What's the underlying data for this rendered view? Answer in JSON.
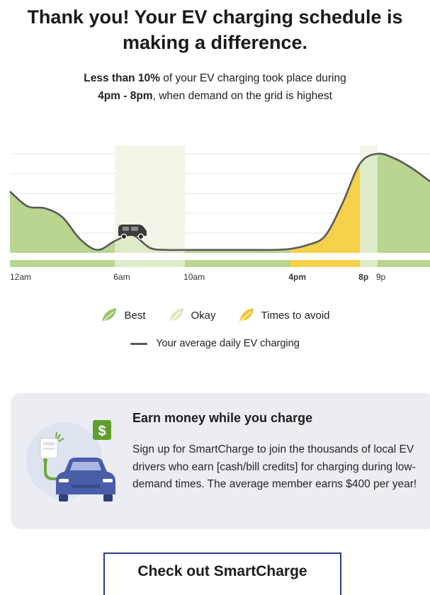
{
  "header": {
    "title": "Thank you! Your EV charging schedule is making a difference.",
    "sub_b1": "Less than 10%",
    "sub_t1": " of your EV charging took place during ",
    "sub_b2": "4pm - 8pm",
    "sub_t2": ", when demand on the grid is highest"
  },
  "chart_data": {
    "type": "area",
    "x": [
      0,
      1,
      2,
      3,
      4,
      5,
      6,
      7,
      8,
      9,
      10,
      11,
      12,
      13,
      14,
      15,
      16,
      17,
      18,
      19,
      20,
      21,
      22,
      23,
      24
    ],
    "series": [
      {
        "values": [
          0.62,
          0.47,
          0.45,
          0.36,
          0.14,
          0.03,
          0.12,
          0.18,
          0.05,
          0.03,
          0.03,
          0.03,
          0.03,
          0.03,
          0.03,
          0.03,
          0.04,
          0.08,
          0.17,
          0.5,
          0.9,
          1.0,
          0.95,
          0.85,
          0.72
        ]
      }
    ],
    "tick_labels": [
      {
        "x": 0,
        "label": "12am",
        "bold": false
      },
      {
        "x": 6,
        "label": "6am",
        "bold": false
      },
      {
        "x": 10,
        "label": "10am",
        "bold": false
      },
      {
        "x": 16,
        "label": "4pm",
        "bold": true
      },
      {
        "x": 20,
        "label": "8p",
        "bold": true
      },
      {
        "x": 21,
        "label": "9p",
        "bold": false
      }
    ],
    "bands": [
      {
        "from": 0,
        "to": 6,
        "category": "best"
      },
      {
        "from": 6,
        "to": 10,
        "category": "okay"
      },
      {
        "from": 10,
        "to": 16,
        "category": "best"
      },
      {
        "from": 16,
        "to": 20,
        "category": "avoid"
      },
      {
        "from": 20,
        "to": 21,
        "category": "okay"
      },
      {
        "from": 21,
        "to": 24,
        "category": "best"
      }
    ],
    "car_marker_x": 7,
    "grid": true,
    "colors": {
      "best": "#b9d58f",
      "okay": "#deebc8",
      "avoid": "#f5d04a",
      "line": "#5a5a5a",
      "grid": "#e4e4e4"
    }
  },
  "legend": {
    "best": "Best",
    "okay": "Okay",
    "avoid": "Times to avoid",
    "line": "Your average daily EV charging",
    "best_icon": "leaf-icon",
    "okay_icon": "leaf-outline-icon",
    "avoid_icon": "leaf-yellow-icon"
  },
  "promo": {
    "title": "Earn money while you charge",
    "body": "Sign up for SmartCharge to join the thousands of local EV drivers who earn [cash/bill credits] for charging during low-demand times. The average member earns $400 per year!",
    "badge": "$",
    "illustration": "ev-charging-car-icon"
  },
  "cta": {
    "label": "Check out SmartCharge"
  }
}
